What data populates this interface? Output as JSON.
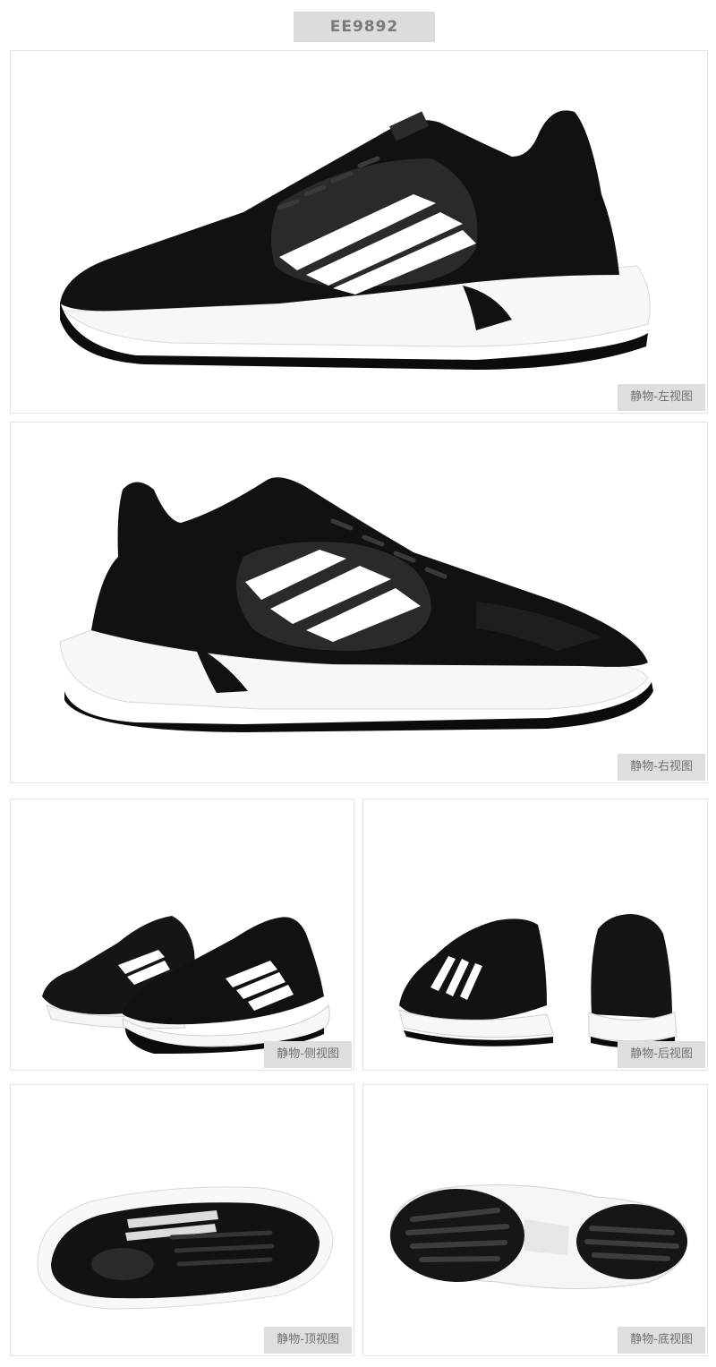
{
  "header": {
    "product_code": "EE9892"
  },
  "panels": {
    "left_view": {
      "caption": "静物-左视图"
    },
    "right_view": {
      "caption": "静物-右视图"
    },
    "side_view": {
      "caption": "静物-侧视图"
    },
    "back_view": {
      "caption": "静物-后视图"
    },
    "top_view": {
      "caption": "静物-顶视图"
    },
    "sole_view": {
      "caption": "静物-底视图"
    }
  },
  "colors": {
    "shoe_upper": "#111111",
    "shoe_panel": "#2a2a2a",
    "stripes": "#ffffff",
    "midsole": "#f7f7f7",
    "outsole": "#0c0c0c",
    "caption_bg": "#dedede",
    "caption_text": "#6f6f6f",
    "badge_bg": "#dcdcdc",
    "badge_text": "#7a7a7a"
  }
}
